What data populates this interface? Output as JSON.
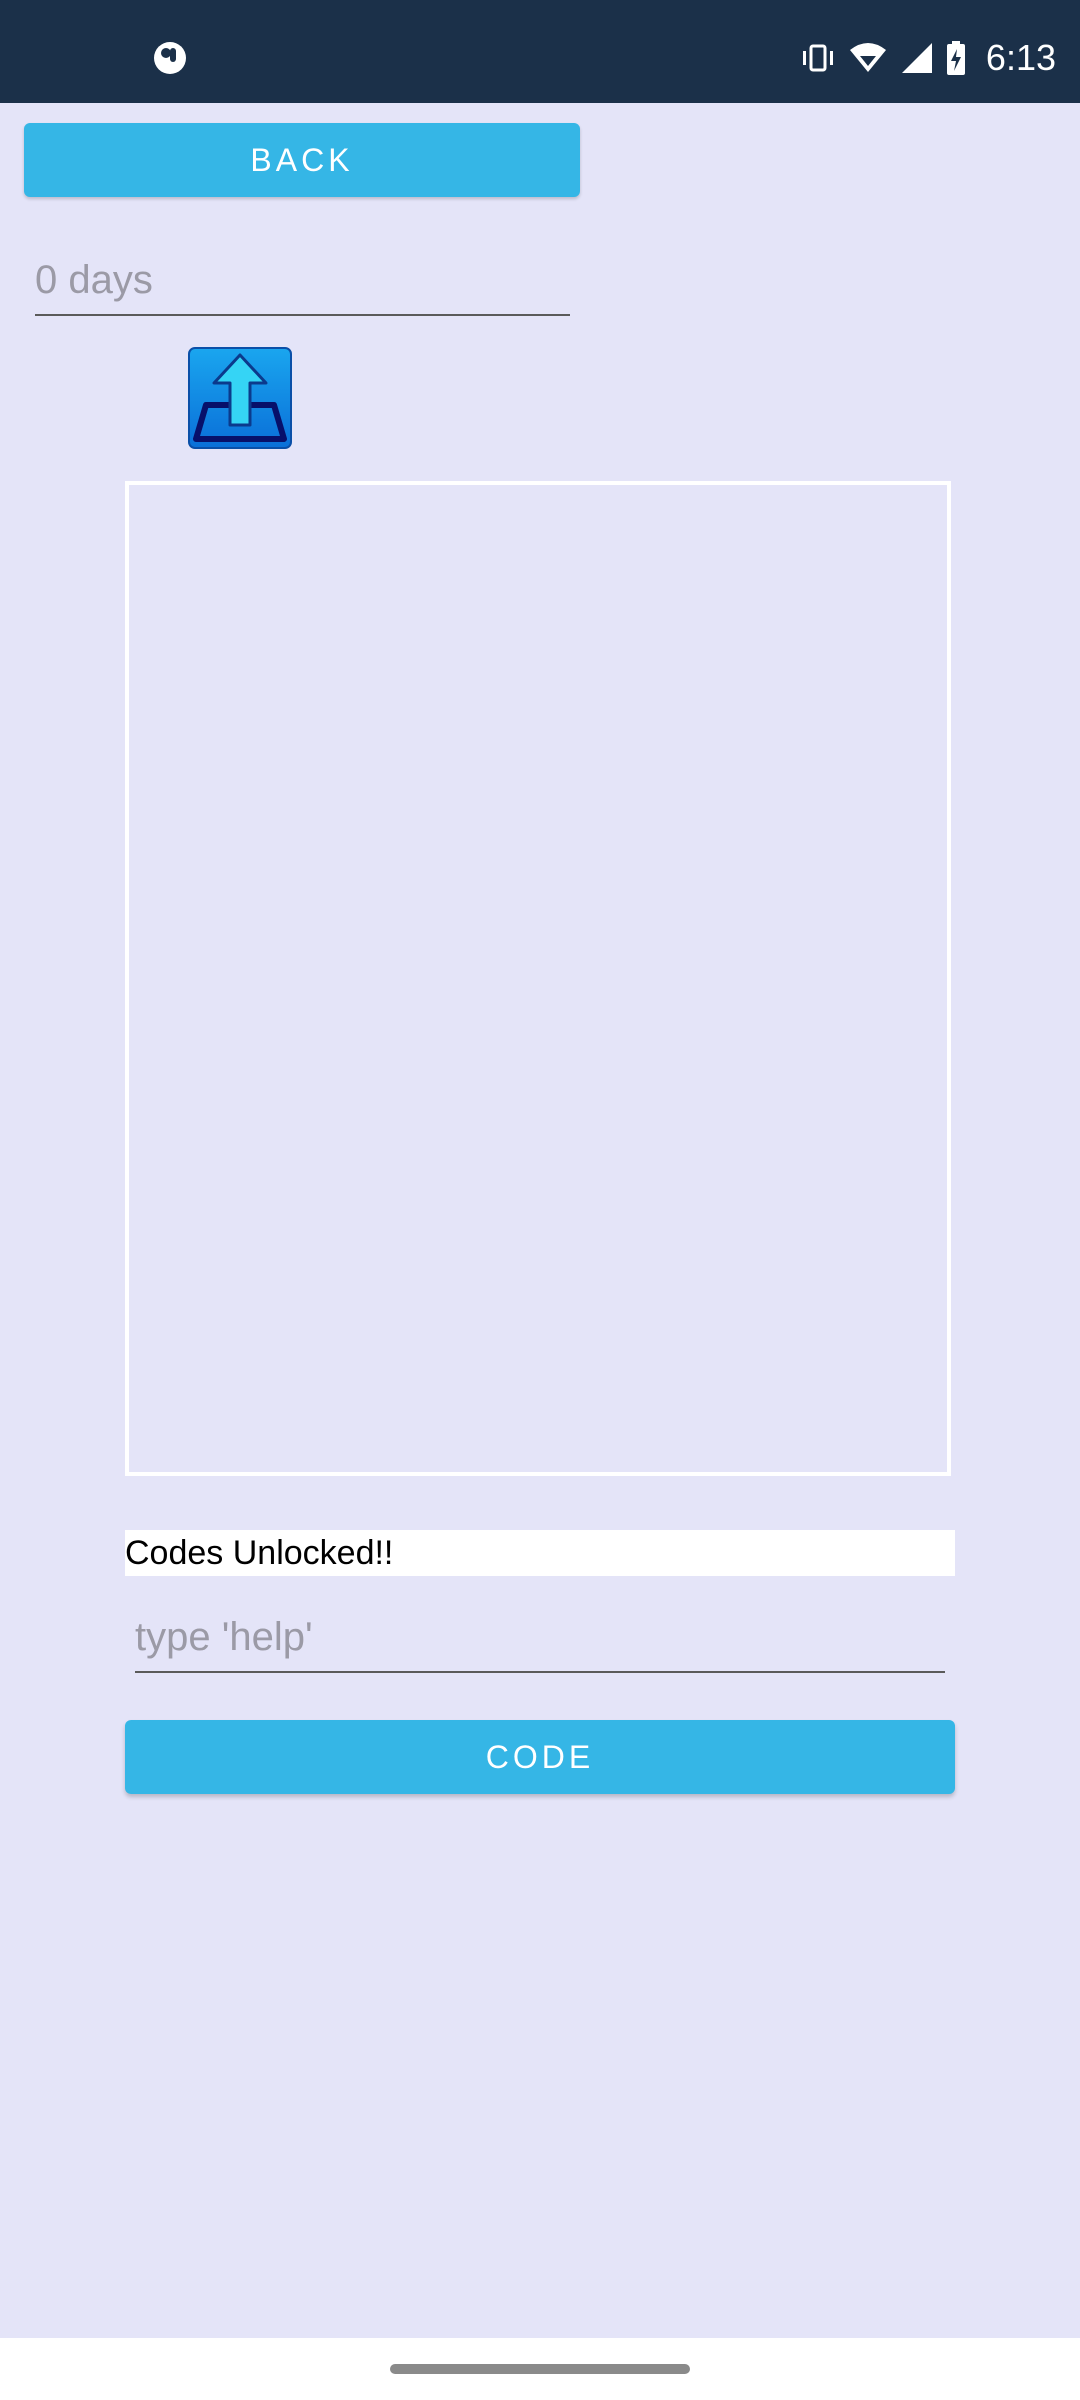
{
  "status_bar": {
    "time": "6:13",
    "icons": [
      "app-notification-icon",
      "vibrate-icon",
      "wifi-icon",
      "signal-icon",
      "battery-charging-icon"
    ]
  },
  "back_button": {
    "label": "BACK"
  },
  "days_field": {
    "text": "0 days"
  },
  "upload_icon": {
    "name": "upload-icon"
  },
  "result_text": {
    "text": "Codes Unlocked!!"
  },
  "code_input": {
    "value": "",
    "placeholder": "type 'help'"
  },
  "code_button": {
    "label": "CODE"
  },
  "colors": {
    "background": "#e4e4f8",
    "status_bar": "#1b3049",
    "button": "#35b6e6"
  }
}
